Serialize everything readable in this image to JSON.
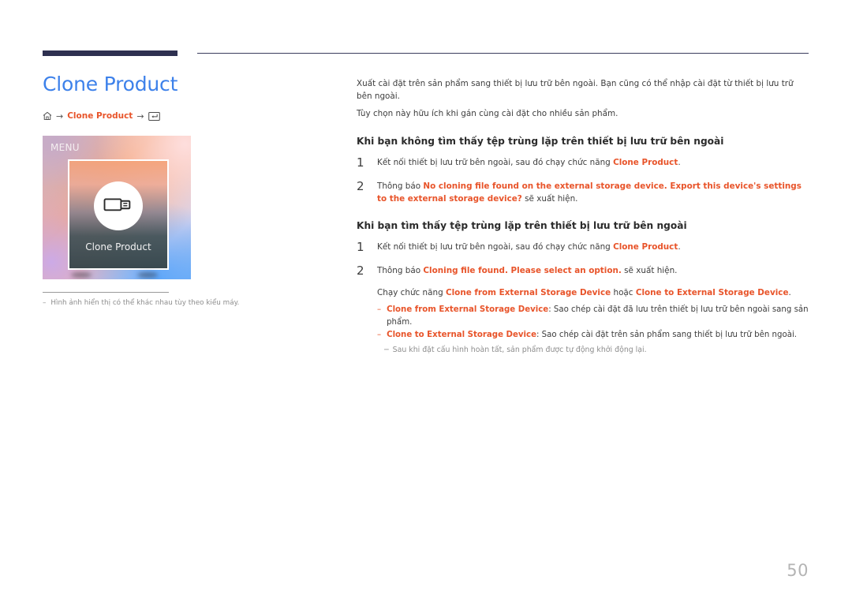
{
  "page": {
    "title": "Clone Product",
    "number": "50",
    "accent_color": "#e8542a",
    "title_color": "#3d81ea",
    "rule_color": "#2e3050"
  },
  "breadcrumb": {
    "home_icon": "home-icon",
    "separator": "→",
    "item": "Clone Product",
    "enter_icon": "enter-key-icon"
  },
  "menu_shot": {
    "menu_label": "MENU",
    "item_label": "Clone Product",
    "icon": "usb-drive-icon"
  },
  "left_note": {
    "dash": "–",
    "text": "Hình ảnh hiển thị có thể khác nhau tùy theo kiểu máy."
  },
  "intro": {
    "p1": "Xuất cài đặt trên sản phẩm sang thiết bị lưu trữ bên ngoài. Bạn cũng có thể nhập cài đặt từ thiết bị lưu trữ bên ngoài.",
    "p2": "Tùy chọn này hữu ích khi gán cùng cài đặt cho nhiều sản phẩm."
  },
  "section1": {
    "heading": "Khi bạn không tìm thấy tệp trùng lặp trên thiết bị lưu trữ bên ngoài",
    "steps": [
      {
        "num": "1",
        "pre": "Kết nối thiết bị lưu trữ bên ngoài, sau đó chạy chức năng ",
        "hl": "Clone Product",
        "post": "."
      },
      {
        "num": "2",
        "pre": "Thông báo ",
        "hl": "No cloning file found on the external storage device. Export this device's settings to the external storage device?",
        "post": " sẽ xuất hiện."
      }
    ]
  },
  "section2": {
    "heading": "Khi bạn tìm thấy tệp trùng lặp trên thiết bị lưu trữ bên ngoài",
    "step1": {
      "num": "1",
      "pre": "Kết nối thiết bị lưu trữ bên ngoài, sau đó chạy chức năng ",
      "hl": "Clone Product",
      "post": "."
    },
    "step2": {
      "num": "2",
      "pre": "Thông báo ",
      "hl": "Cloning file found. Please select an option.",
      "post": " sẽ xuất hiện.",
      "run_pre": "Chạy chức năng ",
      "run_hl1": "Clone from External Storage Device",
      "run_mid": " hoặc ",
      "run_hl2": "Clone to External Storage Device",
      "run_post": ".",
      "options": [
        {
          "dash": "–",
          "hl": "Clone from External Storage Device",
          "text": ": Sao chép cài đặt đã lưu trên thiết bị lưu trữ bên ngoài sang sản phẩm."
        },
        {
          "dash": "–",
          "hl": "Clone to External Storage Device",
          "text": ": Sao chép cài đặt trên sản phẩm sang thiết bị lưu trữ bên ngoài."
        }
      ]
    },
    "tail_note": {
      "dash": "─",
      "text": "Sau khi đặt cấu hình hoàn tất, sản phẩm được tự động khởi động lại."
    }
  }
}
